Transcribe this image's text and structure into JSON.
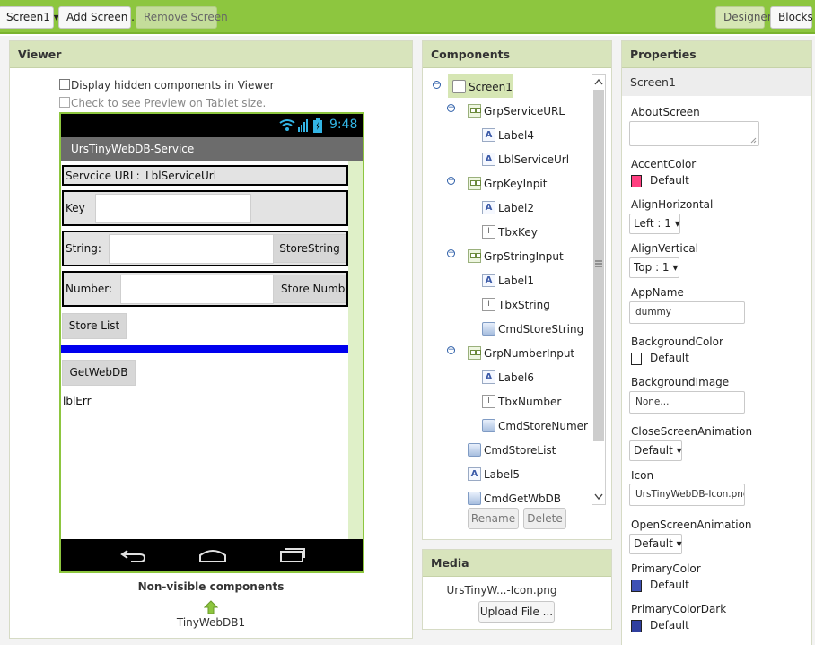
{
  "toolbar": {
    "screen_select": "Screen1 ▾",
    "add_screen": "Add Screen ...",
    "remove_screen": "Remove Screen",
    "designer": "Designer",
    "blocks": "Blocks"
  },
  "viewer": {
    "title": "Viewer",
    "display_hidden": "Display hidden components in Viewer",
    "tablet_preview": "Check to see Preview on Tablet size.",
    "status_time": "9:48",
    "app_title": "UrsTinyWebDB-Service",
    "service_url_label": "Servcice URL:",
    "service_url_value": "LblServiceUrl",
    "key_label": "Key",
    "string_label": "String:",
    "store_string_btn": "StoreString",
    "number_label": "Number:",
    "store_number_btn": "Store Numbe",
    "store_list_btn": "Store List",
    "get_webdb_btn": "GetWebDB",
    "lbl_err": "lblErr",
    "non_visible_title": "Non-visible components",
    "non_visible_item": "TinyWebDB1",
    "accent_blue": "#0000ee"
  },
  "components": {
    "title": "Components",
    "screen": "Screen1",
    "items": [
      "GrpServiceURL",
      "Label4",
      "LblServiceUrl",
      "GrpKeyInpit",
      "Label2",
      "TbxKey",
      "GrpStringInput",
      "Label1",
      "TbxString",
      "CmdStoreString",
      "GrpNumberInput",
      "Label6",
      "TbxNumber",
      "CmdStoreNumer",
      "CmdStoreList",
      "Label5",
      "CmdGetWbDB"
    ],
    "rename": "Rename",
    "delete": "Delete"
  },
  "media": {
    "title": "Media",
    "file": "UrsTinyW...-Icon.png",
    "upload": "Upload File ..."
  },
  "properties": {
    "title": "Properties",
    "component": "Screen1",
    "about_screen": "AboutScreen",
    "accent_color": "AccentColor",
    "accent_value": "Default",
    "accent_swatch": "#ff4081",
    "align_horizontal": "AlignHorizontal",
    "align_horizontal_value": "Left : 1 ▾",
    "align_vertical": "AlignVertical",
    "align_vertical_value": "Top : 1 ▾",
    "app_name": "AppName",
    "app_name_value": "dummy",
    "background_color": "BackgroundColor",
    "background_value": "Default",
    "background_swatch": "#ffffff",
    "background_image": "BackgroundImage",
    "background_image_value": "None...",
    "close_anim": "CloseScreenAnimation",
    "close_anim_value": "Default ▾",
    "icon": "Icon",
    "icon_value": "UrsTinyWebDB-Icon.png",
    "open_anim": "OpenScreenAnimation",
    "open_anim_value": "Default ▾",
    "primary_color": "PrimaryColor",
    "primary_value": "Default",
    "primary_swatch": "#3f51b5",
    "primary_dark": "PrimaryColorDark",
    "primary_dark_value": "Default",
    "primary_dark_swatch": "#303f9f"
  }
}
